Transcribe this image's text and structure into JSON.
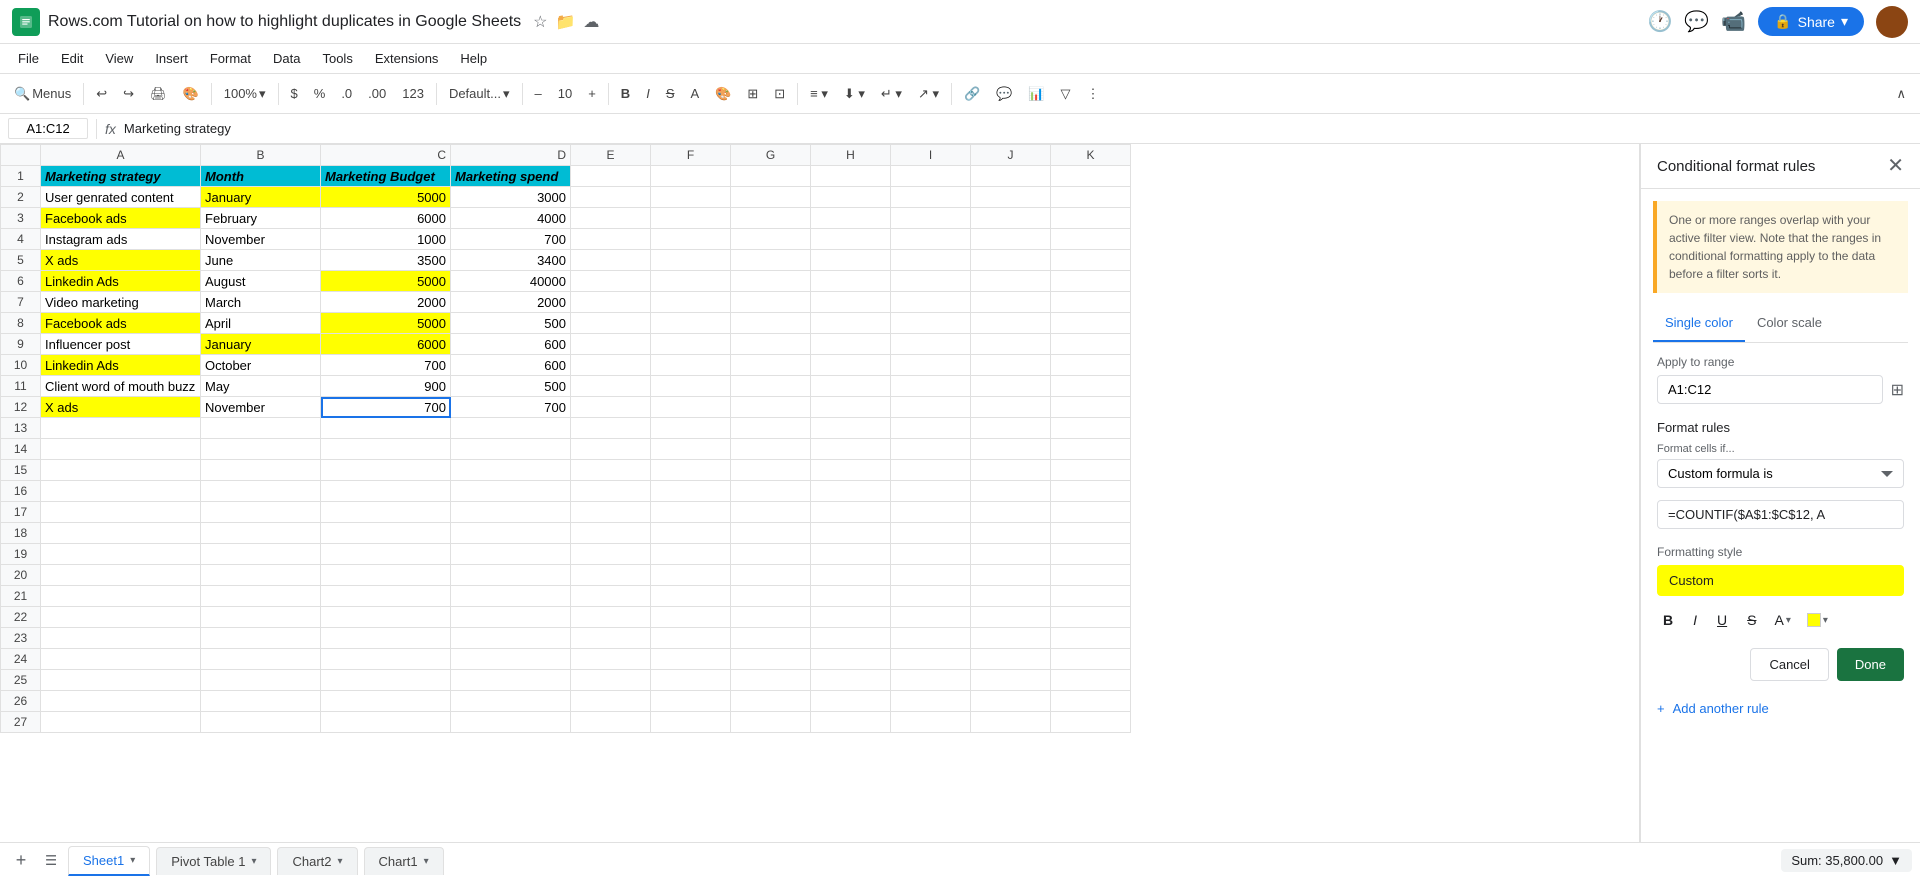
{
  "app": {
    "logo_color": "#0f9d58",
    "doc_title": "Rows.com Tutorial on how to highlight duplicates in Google Sheets"
  },
  "menu": {
    "items": [
      "File",
      "Edit",
      "View",
      "Insert",
      "Format",
      "Data",
      "Tools",
      "Extensions",
      "Help"
    ]
  },
  "toolbar": {
    "zoom": "100%",
    "font": "Default...",
    "font_size": "10"
  },
  "formula_bar": {
    "cell_ref": "A1:C12",
    "formula": "Marketing strategy"
  },
  "spreadsheet": {
    "col_headers": [
      "",
      "A",
      "B",
      "C",
      "D",
      "E",
      "F",
      "G",
      "H",
      "I",
      "J",
      "K"
    ],
    "rows": [
      {
        "row_num": "1",
        "a": "Marketing strategy",
        "b": "Month",
        "c": "Marketing Budget",
        "d": "Marketing spend",
        "highlight_a": false,
        "highlight_b": false,
        "highlight_c": false,
        "is_header": true
      },
      {
        "row_num": "2",
        "a": "User genrated content",
        "b": "January",
        "c": "5000",
        "d": "3000",
        "highlight_a": false,
        "highlight_b": true,
        "highlight_c": true,
        "is_header": false
      },
      {
        "row_num": "3",
        "a": "Facebook ads",
        "b": "February",
        "c": "6000",
        "d": "4000",
        "highlight_a": true,
        "highlight_b": false,
        "highlight_c": false,
        "is_header": false
      },
      {
        "row_num": "4",
        "a": "Instagram ads",
        "b": "November",
        "c": "1000",
        "d": "700",
        "highlight_a": false,
        "highlight_b": false,
        "highlight_c": false,
        "is_header": false
      },
      {
        "row_num": "5",
        "a": "X ads",
        "b": "June",
        "c": "3500",
        "d": "3400",
        "highlight_a": true,
        "highlight_b": false,
        "highlight_c": false,
        "is_header": false
      },
      {
        "row_num": "6",
        "a": "Linkedin Ads",
        "b": "August",
        "c": "5000",
        "d": "40000",
        "highlight_a": true,
        "highlight_b": false,
        "highlight_c": true,
        "is_header": false
      },
      {
        "row_num": "7",
        "a": "Video marketing",
        "b": "March",
        "c": "2000",
        "d": "2000",
        "highlight_a": false,
        "highlight_b": false,
        "highlight_c": false,
        "is_header": false
      },
      {
        "row_num": "8",
        "a": "Facebook ads",
        "b": "April",
        "c": "5000",
        "d": "500",
        "highlight_a": true,
        "highlight_b": false,
        "highlight_c": true,
        "is_header": false
      },
      {
        "row_num": "9",
        "a": "Influencer post",
        "b": "January",
        "c": "6000",
        "d": "600",
        "highlight_a": false,
        "highlight_b": true,
        "highlight_c": true,
        "is_header": false
      },
      {
        "row_num": "10",
        "a": "Linkedin Ads",
        "b": "October",
        "c": "700",
        "d": "600",
        "highlight_a": true,
        "highlight_b": false,
        "highlight_c": false,
        "is_header": false
      },
      {
        "row_num": "11",
        "a": "Client word of mouth buzz",
        "b": "May",
        "c": "900",
        "d": "500",
        "highlight_a": false,
        "highlight_b": false,
        "highlight_c": false,
        "is_header": false
      },
      {
        "row_num": "12",
        "a": "X ads",
        "b": "November",
        "c": "700",
        "d": "700",
        "highlight_a": true,
        "highlight_b": false,
        "highlight_c": false,
        "is_header": false
      }
    ],
    "empty_rows": [
      "13",
      "14",
      "15",
      "16",
      "17",
      "18",
      "19",
      "20",
      "21",
      "22",
      "23",
      "24",
      "25",
      "26",
      "27"
    ]
  },
  "cf_panel": {
    "title": "Conditional format rules",
    "warning_text": "One or more ranges overlap with your active filter view. Note that the ranges in conditional formatting apply to the data before a filter sorts it.",
    "tab_single": "Single color",
    "tab_scale": "Color scale",
    "apply_to_range_label": "Apply to range",
    "range_value": "A1:C12",
    "format_rules_title": "Format rules",
    "format_cells_if_label": "Format cells if...",
    "dropdown_value": "Custom formula is",
    "formula_value": "=COUNTIF($A$1:$C$12, A",
    "formatting_style_label": "Formatting style",
    "custom_label": "Custom",
    "cancel_btn": "Cancel",
    "done_btn": "Done",
    "add_rule_label": "+ Add another rule",
    "bold": "B",
    "italic": "I",
    "underline": "U",
    "strikethrough": "S"
  },
  "bottom_bar": {
    "sheets": [
      {
        "name": "Sheet1",
        "active": true
      },
      {
        "name": "Pivot Table 1",
        "active": false
      },
      {
        "name": "Chart2",
        "active": false
      },
      {
        "name": "Chart1",
        "active": false
      }
    ],
    "sum_label": "Sum: 35,800.00",
    "sum_arrow": "▼"
  },
  "top_right": {
    "share_label": "Share",
    "share_lock_icon": "🔒"
  }
}
